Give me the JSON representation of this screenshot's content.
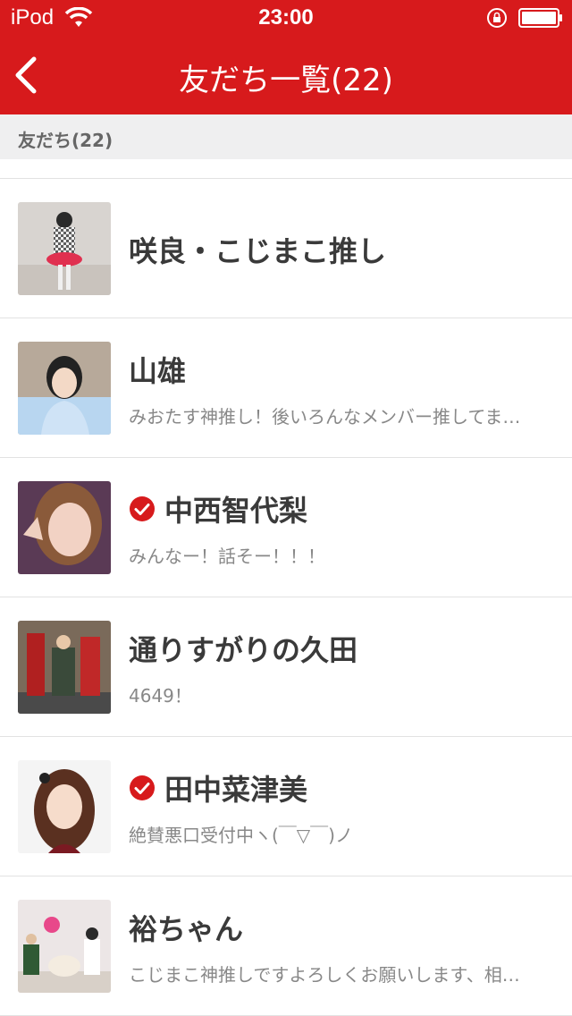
{
  "status_bar": {
    "carrier": "iPod",
    "time": "23:00"
  },
  "nav": {
    "title": "友だち一覧(22)"
  },
  "section": {
    "header": "友だち(22)"
  },
  "accent_color": "#d71a1c",
  "friends": [
    {
      "name": "咲良・こじまこ推し",
      "message": "",
      "verified": false
    },
    {
      "name": "山雄",
      "message": "みおたす神推し！後いろんなメンバー推してま…",
      "verified": false
    },
    {
      "name": "中西智代梨",
      "message": "みんなー！話そー！！！",
      "verified": true
    },
    {
      "name": "通りすがりの久田",
      "message": "4649！",
      "verified": false
    },
    {
      "name": "田中菜津美",
      "message": "絶賛悪口受付中ヽ(￣▽￣)ノ",
      "verified": true
    },
    {
      "name": "裕ちゃん",
      "message": "こじまこ神推しですよろしくお願いします、相…",
      "verified": false
    }
  ]
}
